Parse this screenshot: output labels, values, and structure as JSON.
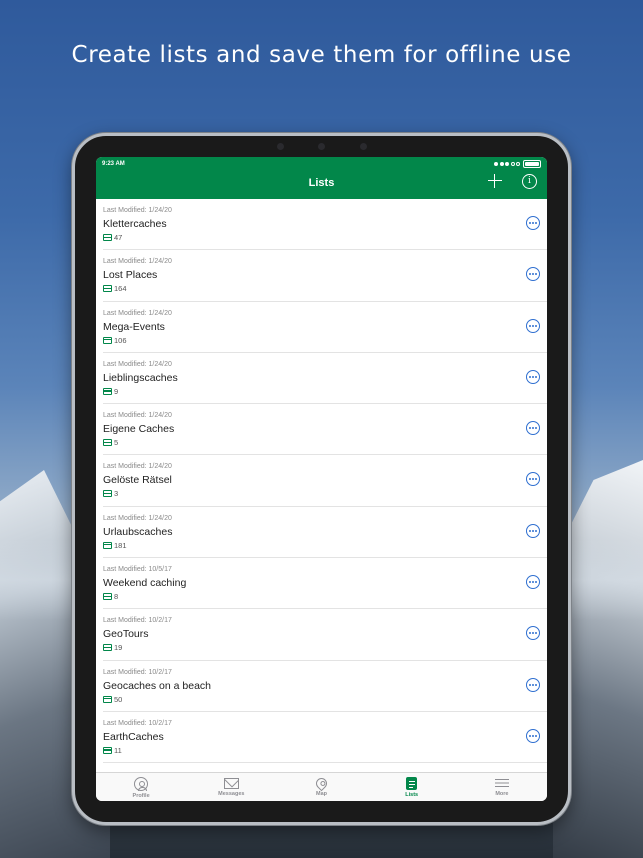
{
  "headline": "Create lists and save them for offline use",
  "status_bar": {
    "time": "9:23 AM"
  },
  "nav": {
    "title": "Lists",
    "add_icon": "plus-icon",
    "info_icon": "info-icon",
    "info_glyph": "i"
  },
  "colors": {
    "brand_green": "#02874a",
    "more_button_blue": "#2f6fd0"
  },
  "lists": [
    {
      "meta": "Last Modified: 1/24/20",
      "title": "Klettercaches",
      "count": "47"
    },
    {
      "meta": "Last Modified: 1/24/20",
      "title": "Lost Places",
      "count": "164"
    },
    {
      "meta": "Last Modified: 1/24/20",
      "title": "Mega-Events",
      "count": "106"
    },
    {
      "meta": "Last Modified: 1/24/20",
      "title": "Lieblingscaches",
      "count": "9"
    },
    {
      "meta": "Last Modified: 1/24/20",
      "title": "Eigene Caches",
      "count": "5"
    },
    {
      "meta": "Last Modified: 1/24/20",
      "title": "Gelöste Rätsel",
      "count": "3"
    },
    {
      "meta": "Last Modified: 1/24/20",
      "title": "Urlaubscaches",
      "count": "181"
    },
    {
      "meta": "Last Modified: 10/5/17",
      "title": "Weekend caching",
      "count": "8"
    },
    {
      "meta": "Last Modified: 10/2/17",
      "title": "GeoTours",
      "count": "19"
    },
    {
      "meta": "Last Modified: 10/2/17",
      "title": "Geocaches on a beach",
      "count": "50"
    },
    {
      "meta": "Last Modified: 10/2/17",
      "title": "EarthCaches",
      "count": "11"
    }
  ],
  "tabs": [
    {
      "label": "Profile",
      "icon": "profile-icon"
    },
    {
      "label": "Messages",
      "icon": "messages-icon"
    },
    {
      "label": "Map",
      "icon": "map-pin-icon"
    },
    {
      "label": "Lists",
      "icon": "lists-icon",
      "active": true
    },
    {
      "label": "More",
      "icon": "menu-icon"
    }
  ]
}
